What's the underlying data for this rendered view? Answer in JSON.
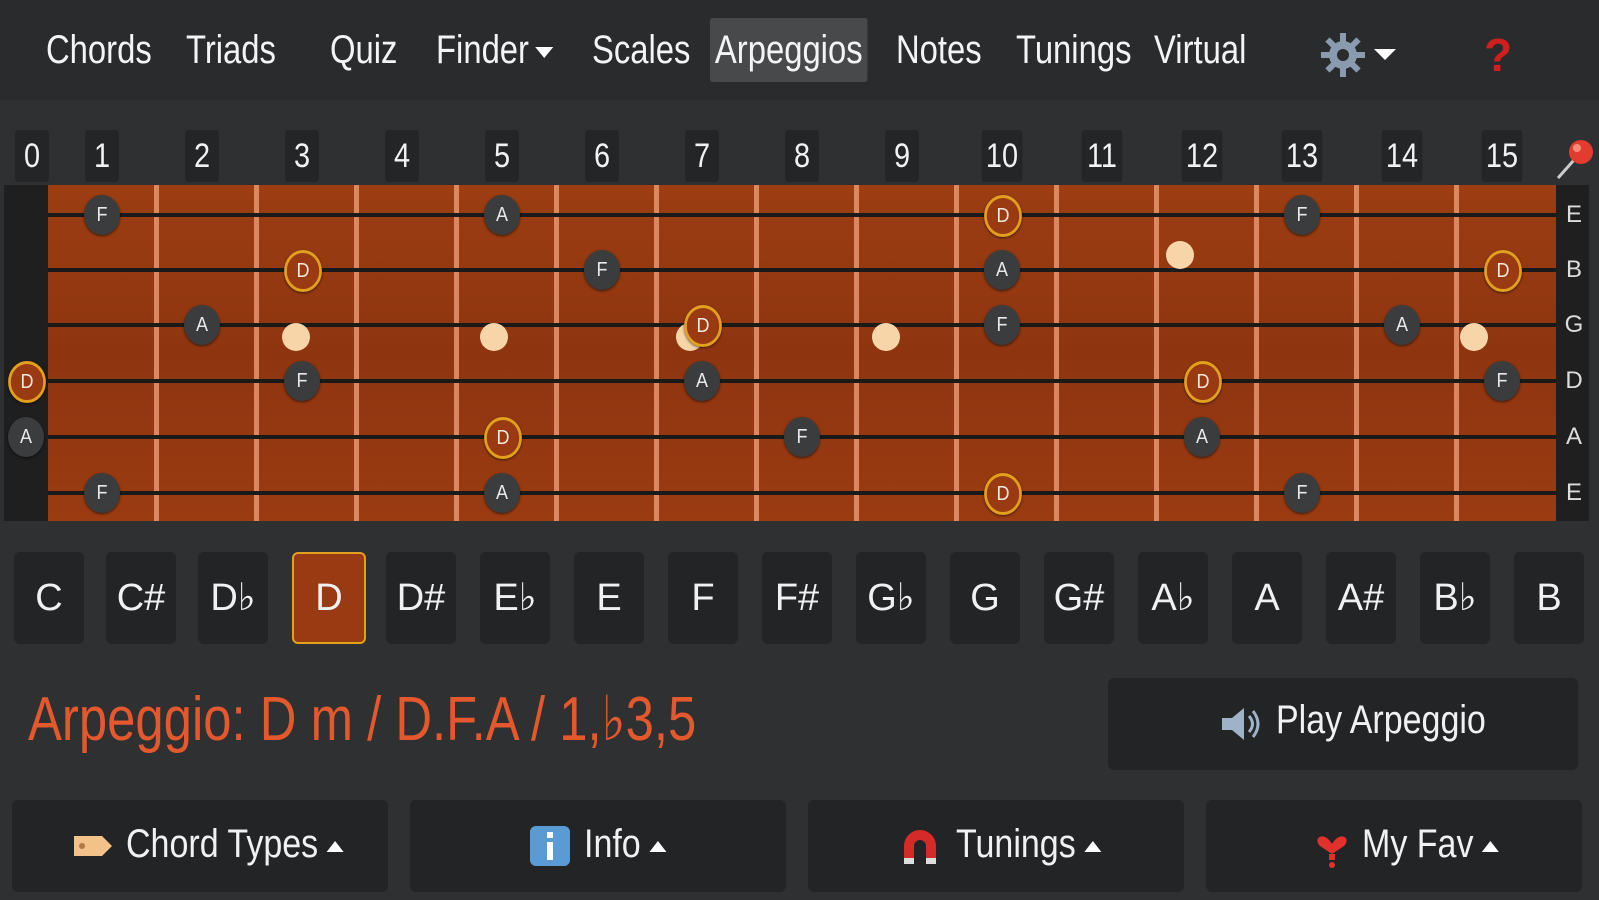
{
  "nav": {
    "items": [
      "Chords",
      "Triads",
      "Quiz",
      "Finder",
      "Scales",
      "Arpeggios",
      "Notes",
      "Tunings",
      "Virtual"
    ],
    "active": "Arpeggios",
    "help": "?"
  },
  "frets": [
    "0",
    "1",
    "2",
    "3",
    "4",
    "5",
    "6",
    "7",
    "8",
    "9",
    "10",
    "11",
    "12",
    "13",
    "14",
    "15"
  ],
  "strings": [
    "E",
    "B",
    "G",
    "D",
    "A",
    "E"
  ],
  "notes": [
    {
      "string": 0,
      "fret": 1,
      "label": "F",
      "root": false
    },
    {
      "string": 0,
      "fret": 5,
      "label": "A",
      "root": false
    },
    {
      "string": 0,
      "fret": 10,
      "label": "D",
      "root": true
    },
    {
      "string": 0,
      "fret": 13,
      "label": "F",
      "root": false
    },
    {
      "string": 1,
      "fret": 3,
      "label": "D",
      "root": true
    },
    {
      "string": 1,
      "fret": 6,
      "label": "F",
      "root": false
    },
    {
      "string": 1,
      "fret": 10,
      "label": "A",
      "root": false
    },
    {
      "string": 1,
      "fret": 15,
      "label": "D",
      "root": true
    },
    {
      "string": 2,
      "fret": 2,
      "label": "A",
      "root": false
    },
    {
      "string": 2,
      "fret": 7,
      "label": "D",
      "root": true
    },
    {
      "string": 2,
      "fret": 10,
      "label": "F",
      "root": false
    },
    {
      "string": 2,
      "fret": 14,
      "label": "A",
      "root": false
    },
    {
      "string": 3,
      "fret": 0,
      "label": "D",
      "root": true
    },
    {
      "string": 3,
      "fret": 3,
      "label": "F",
      "root": false
    },
    {
      "string": 3,
      "fret": 7,
      "label": "A",
      "root": false
    },
    {
      "string": 3,
      "fret": 12,
      "label": "D",
      "root": true
    },
    {
      "string": 3,
      "fret": 15,
      "label": "F",
      "root": false
    },
    {
      "string": 4,
      "fret": 0,
      "label": "A",
      "root": false
    },
    {
      "string": 4,
      "fret": 5,
      "label": "D",
      "root": true
    },
    {
      "string": 4,
      "fret": 8,
      "label": "F",
      "root": false
    },
    {
      "string": 4,
      "fret": 12,
      "label": "A",
      "root": false
    },
    {
      "string": 5,
      "fret": 1,
      "label": "F",
      "root": false
    },
    {
      "string": 5,
      "fret": 5,
      "label": "A",
      "root": false
    },
    {
      "string": 5,
      "fret": 10,
      "label": "D",
      "root": true
    },
    {
      "string": 5,
      "fret": 13,
      "label": "F",
      "root": false
    }
  ],
  "keys": [
    "C",
    "C#",
    "D♭",
    "D",
    "D#",
    "E♭",
    "E",
    "F",
    "F#",
    "G♭",
    "G",
    "G#",
    "A♭",
    "A",
    "A#",
    "B♭",
    "B"
  ],
  "active_key": "D",
  "arpeggio": {
    "title": "Arpeggio: D m / D.F.A / 1,♭3,5",
    "play_label": "Play Arpeggio"
  },
  "bottom": {
    "chord_types": "Chord Types",
    "info": "Info",
    "tunings": "Tunings",
    "my_fav": "My Fav"
  },
  "colors": {
    "accent": "#e3582c",
    "root_border": "#e3a01d",
    "wood": "#9c3d12",
    "help": "#d01f1f"
  }
}
